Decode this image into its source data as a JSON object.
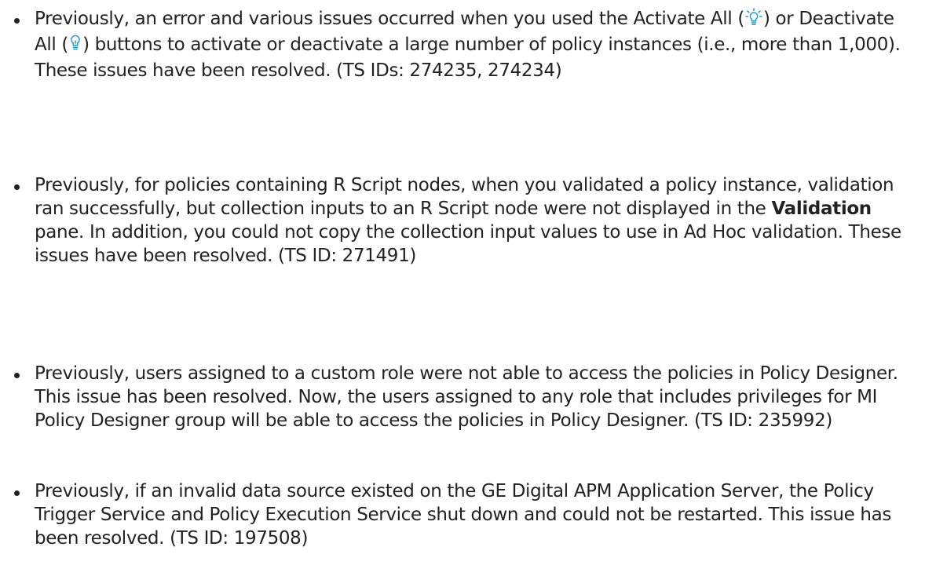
{
  "notes": [
    {
      "part1": "Previously, an error and various issues occurred when you used the Activate All (",
      "icon1": "lightbulb-on-icon",
      "part2": ") or Deactivate All (",
      "icon2": "lightbulb-off-icon",
      "part3": ") buttons to activate or deactivate a large number of policy instances (i.e., more than 1,000). These issues have been resolved. (TS IDs: 274235, 274234)"
    },
    {
      "part1": "Previously, for policies containing R Script nodes, when you validated a policy instance, validation ran successfully, but collection inputs to an R Script node were not displayed in the ",
      "bold": "Validation",
      "part2": " pane. In addition, you could not copy the collection input values to use in Ad Hoc validation. These issues have been resolved. (TS ID: 271491)"
    },
    {
      "text": "Previously, users assigned to a custom role were not able to access the policies in Policy Designer. This issue has been resolved. Now, the users assigned to any role that includes privileges for MI Policy Designer group will be able to access the policies in Policy Designer. (TS ID: 235992)"
    },
    {
      "text": "Previously, if an invalid data source existed on the GE Digital APM Application Server, the Policy Trigger Service and Policy Execution Service shut down and could not be restarted. This issue has been resolved. (TS ID: 197508)"
    }
  ],
  "colors": {
    "text": "#222222",
    "icon": "#1a9bd7"
  }
}
